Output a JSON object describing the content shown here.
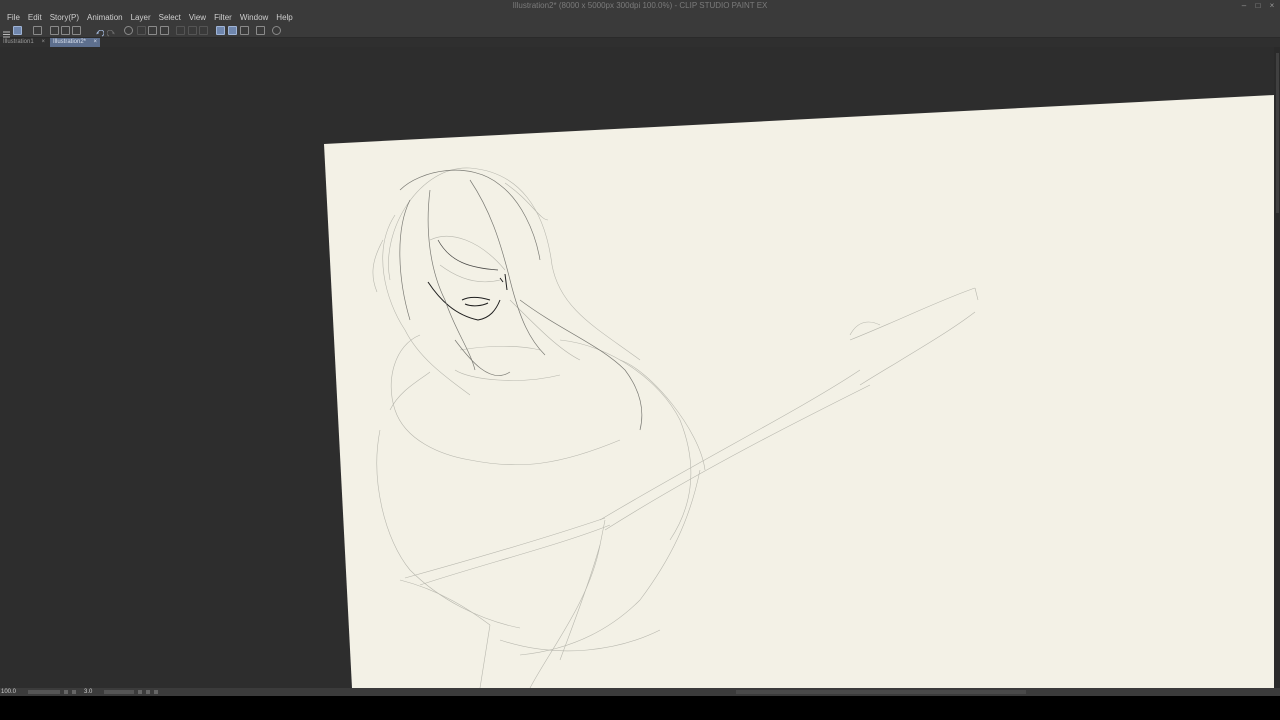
{
  "window": {
    "title": "Illustration2* (8000 x 5000px 300dpi 100.0%)  - CLIP STUDIO PAINT EX",
    "controls": [
      "–",
      "□",
      "×"
    ]
  },
  "menu": [
    "File",
    "Edit",
    "Story(P)",
    "Animation",
    "Layer",
    "Select",
    "View",
    "Filter",
    "Window",
    "Help"
  ],
  "tabs": [
    {
      "label": "Illustration1",
      "active": false
    },
    {
      "label": "Illustration2*",
      "active": true
    }
  ],
  "status": {
    "zoom": "100.0",
    "angle": "3.0"
  },
  "colors": {
    "paper": "#f3f1e6",
    "workspace": "#2d2d2d",
    "active_tool": "#6f86ad"
  }
}
